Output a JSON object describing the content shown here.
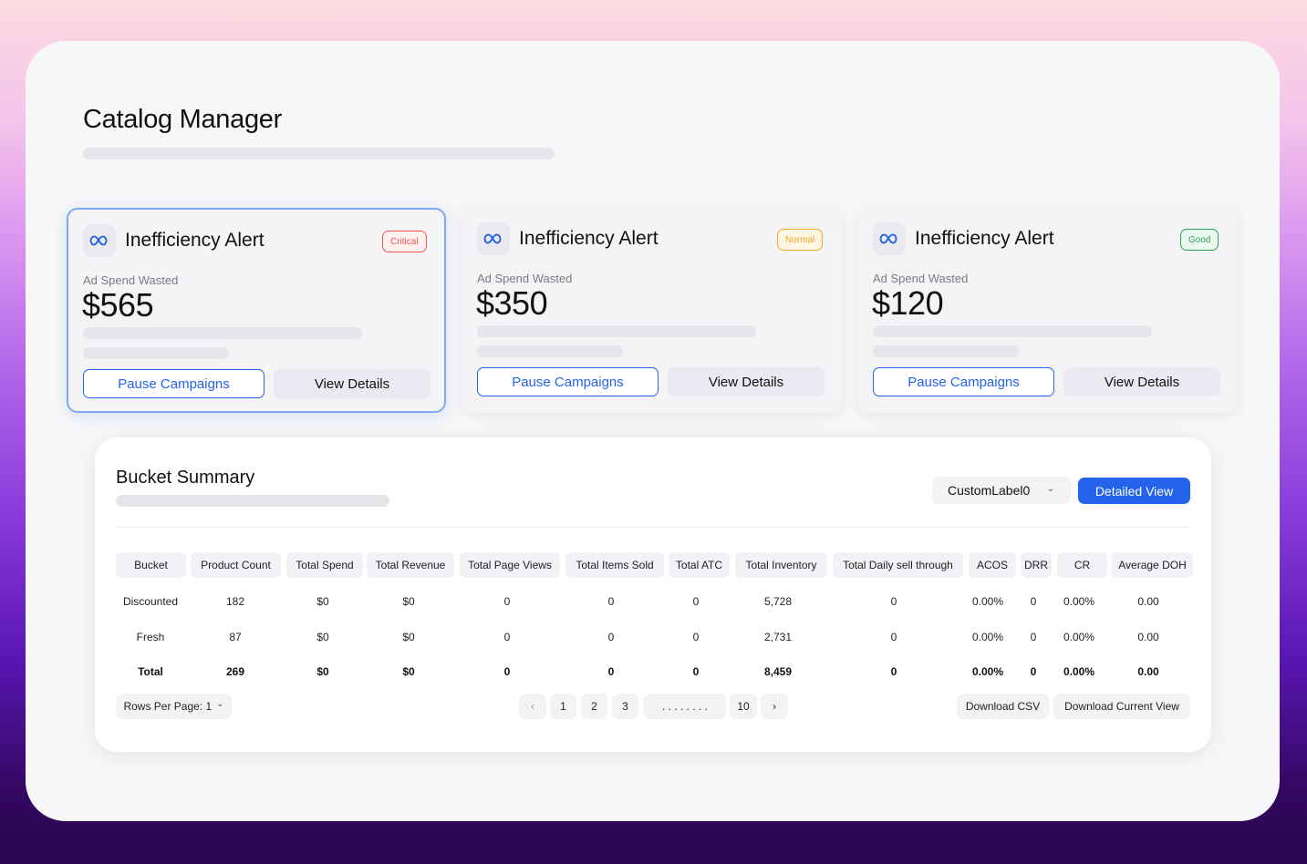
{
  "page": {
    "title": "Catalog Manager"
  },
  "cards": [
    {
      "title": "Inefficiency Alert",
      "badge": "Critical",
      "label": "Ad Spend Wasted",
      "value": "$565",
      "pause_label": "Pause Campaigns",
      "details_label": "View Details",
      "icon": "meta-logo-icon"
    },
    {
      "title": "Inefficiency Alert",
      "badge": "Normal",
      "label": "Ad Spend Wasted",
      "value": "$350",
      "pause_label": "Pause Campaigns",
      "details_label": "View Details",
      "icon": "meta-logo-icon"
    },
    {
      "title": "Inefficiency Alert",
      "badge": "Good",
      "label": "Ad Spend Wasted",
      "value": "$120",
      "pause_label": "Pause Campaigns",
      "details_label": "View Details",
      "icon": "meta-logo-icon"
    }
  ],
  "summary": {
    "title": "Bucket Summary",
    "dropdown_value": "CustomLabel0",
    "detailed_view_label": "Detailed View",
    "columns": [
      "Bucket",
      "Product Count",
      "Total Spend",
      "Total Revenue",
      "Total Page Views",
      "Total Items Sold",
      "Total ATC",
      "Total Inventory",
      "Total Daily sell through",
      "ACOS",
      "DRR",
      "CR",
      "Average DOH"
    ],
    "rows": [
      [
        "Discounted",
        "182",
        "$0",
        "$0",
        "0",
        "0",
        "0",
        "5,728",
        "0",
        "0.00%",
        "0",
        "0.00%",
        "0.00"
      ],
      [
        "Fresh",
        "87",
        "$0",
        "$0",
        "0",
        "0",
        "0",
        "2,731",
        "0",
        "0.00%",
        "0",
        "0.00%",
        "0.00"
      ],
      [
        "Total",
        "269",
        "$0",
        "$0",
        "0",
        "0",
        "0",
        "8,459",
        "0",
        "0.00%",
        "0",
        "0.00%",
        "0.00"
      ]
    ],
    "rows_per_page_label": "Rows Per Page: 1",
    "pagination": {
      "prev": "‹",
      "pages": [
        "1",
        "2",
        "3",
        ". . . . . . . .",
        "10"
      ],
      "next": "›"
    },
    "download_csv_label": "Download CSV",
    "download_view_label": "Download Current View"
  },
  "colors": {
    "accent": "#2563eb",
    "critical": "#e9584a",
    "normal": "#f0a629",
    "good": "#2fa352"
  }
}
